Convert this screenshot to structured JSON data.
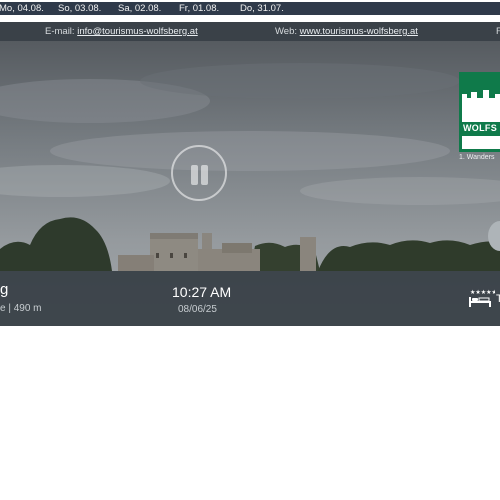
{
  "dates": [
    "Mo, 04.08.",
    "So, 03.08.",
    "Sa, 02.08.",
    "Fr, 01.08.",
    "Do, 31.07."
  ],
  "contact": {
    "email_label": "E-mail:",
    "email": "info@tourismus-wolfsberg.at",
    "web_label": "Web:",
    "web": "www.tourismus-wolfsberg.at",
    "edge_letter": "F"
  },
  "logo": {
    "text": "WOLFS",
    "caption": "1. Wanders"
  },
  "info": {
    "location_partial": "g",
    "subline": "e | 490 m",
    "time": "10:27 AM",
    "date": "08/06/25",
    "edge_letter": "T"
  },
  "icons": {
    "pause": "pause-icon",
    "bed": "bed-hotel-icon"
  },
  "colors": {
    "date_strip": "#2f3a4a",
    "contact_bar": "#3a4148",
    "logo_green": "#0f7a4a"
  }
}
